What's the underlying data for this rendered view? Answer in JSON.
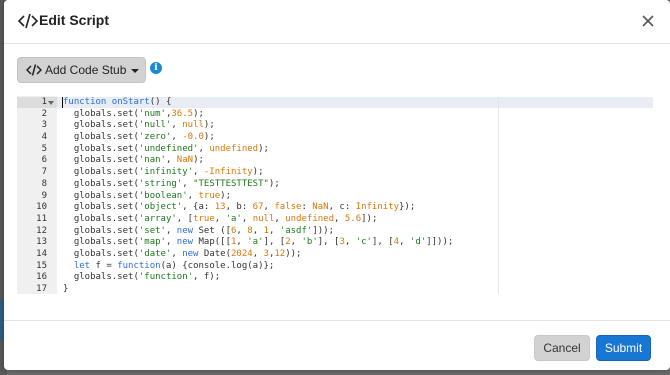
{
  "modal": {
    "title": "Edit Script"
  },
  "toolbar": {
    "add_code_stub_label": "Add Code Stub",
    "info_glyph": "i"
  },
  "editor": {
    "lines": [
      {
        "n": "1",
        "tokens": [
          [
            "k",
            "function"
          ],
          [
            "p",
            " "
          ],
          [
            "fn",
            "onStart"
          ],
          [
            "p",
            "() {"
          ]
        ]
      },
      {
        "n": "2",
        "tokens": [
          [
            "p",
            "  globals.set("
          ],
          [
            "s",
            "'num'"
          ],
          [
            "p",
            ","
          ],
          [
            "c",
            "36.5"
          ],
          [
            "p",
            ");"
          ]
        ]
      },
      {
        "n": "3",
        "tokens": [
          [
            "p",
            "  globals.set("
          ],
          [
            "s",
            "'null'"
          ],
          [
            "p",
            ", "
          ],
          [
            "c",
            "null"
          ],
          [
            "p",
            ");"
          ]
        ]
      },
      {
        "n": "4",
        "tokens": [
          [
            "p",
            "  globals.set("
          ],
          [
            "s",
            "'zero'"
          ],
          [
            "p",
            ", "
          ],
          [
            "c",
            "-0.0"
          ],
          [
            "p",
            ");"
          ]
        ]
      },
      {
        "n": "5",
        "tokens": [
          [
            "p",
            "  globals.set("
          ],
          [
            "s",
            "'undefined'"
          ],
          [
            "p",
            ", "
          ],
          [
            "c",
            "undefined"
          ],
          [
            "p",
            ");"
          ]
        ]
      },
      {
        "n": "6",
        "tokens": [
          [
            "p",
            "  globals.set("
          ],
          [
            "s",
            "'nan'"
          ],
          [
            "p",
            ", "
          ],
          [
            "c",
            "NaN"
          ],
          [
            "p",
            ");"
          ]
        ]
      },
      {
        "n": "7",
        "tokens": [
          [
            "p",
            "  globals.set("
          ],
          [
            "s",
            "'infinity'"
          ],
          [
            "p",
            ", "
          ],
          [
            "c",
            "-Infinity"
          ],
          [
            "p",
            ");"
          ]
        ]
      },
      {
        "n": "8",
        "tokens": [
          [
            "p",
            "  globals.set("
          ],
          [
            "s",
            "'string'"
          ],
          [
            "p",
            ", "
          ],
          [
            "s",
            "\"TESTTESTTEST\""
          ],
          [
            "p",
            ");"
          ]
        ]
      },
      {
        "n": "9",
        "tokens": [
          [
            "p",
            "  globals.set("
          ],
          [
            "s",
            "'boolean'"
          ],
          [
            "p",
            ", "
          ],
          [
            "c",
            "true"
          ],
          [
            "p",
            ");"
          ]
        ]
      },
      {
        "n": "10",
        "tokens": [
          [
            "p",
            "  globals.set("
          ],
          [
            "s",
            "'object'"
          ],
          [
            "p",
            ", {a: "
          ],
          [
            "c",
            "13"
          ],
          [
            "p",
            ", b: "
          ],
          [
            "c",
            "67"
          ],
          [
            "p",
            ", "
          ],
          [
            "c",
            "false"
          ],
          [
            "p",
            ": "
          ],
          [
            "c",
            "NaN"
          ],
          [
            "p",
            ", c: "
          ],
          [
            "c",
            "Infinity"
          ],
          [
            "p",
            "});"
          ]
        ]
      },
      {
        "n": "11",
        "tokens": [
          [
            "p",
            "  globals.set("
          ],
          [
            "s",
            "'array'"
          ],
          [
            "p",
            ", ["
          ],
          [
            "c",
            "true"
          ],
          [
            "p",
            ", "
          ],
          [
            "s",
            "'a'"
          ],
          [
            "p",
            ", "
          ],
          [
            "c",
            "null"
          ],
          [
            "p",
            ", "
          ],
          [
            "c",
            "undefined"
          ],
          [
            "p",
            ", "
          ],
          [
            "c",
            "5.6"
          ],
          [
            "p",
            "]);"
          ]
        ]
      },
      {
        "n": "12",
        "tokens": [
          [
            "p",
            "  globals.set("
          ],
          [
            "s",
            "'set'"
          ],
          [
            "p",
            ", "
          ],
          [
            "k",
            "new"
          ],
          [
            "p",
            " Set (["
          ],
          [
            "c",
            "6"
          ],
          [
            "p",
            ", "
          ],
          [
            "c",
            "8"
          ],
          [
            "p",
            ", "
          ],
          [
            "c",
            "1"
          ],
          [
            "p",
            ", "
          ],
          [
            "s",
            "'asdf'"
          ],
          [
            "p",
            "]));"
          ]
        ]
      },
      {
        "n": "13",
        "tokens": [
          [
            "p",
            "  globals.set("
          ],
          [
            "s",
            "'map'"
          ],
          [
            "p",
            ", "
          ],
          [
            "k",
            "new"
          ],
          [
            "p",
            " Map([["
          ],
          [
            "c",
            "1"
          ],
          [
            "p",
            ", "
          ],
          [
            "s",
            "'a'"
          ],
          [
            "p",
            "], ["
          ],
          [
            "c",
            "2"
          ],
          [
            "p",
            ", "
          ],
          [
            "s",
            "'b'"
          ],
          [
            "p",
            "], ["
          ],
          [
            "c",
            "3"
          ],
          [
            "p",
            ", "
          ],
          [
            "s",
            "'c'"
          ],
          [
            "p",
            "], ["
          ],
          [
            "c",
            "4"
          ],
          [
            "p",
            ", "
          ],
          [
            "s",
            "'d'"
          ],
          [
            "p",
            "]]));"
          ]
        ]
      },
      {
        "n": "14",
        "tokens": [
          [
            "p",
            "  globals.set("
          ],
          [
            "s",
            "'date'"
          ],
          [
            "p",
            ", "
          ],
          [
            "k",
            "new"
          ],
          [
            "p",
            " Date("
          ],
          [
            "c",
            "2024"
          ],
          [
            "p",
            ", "
          ],
          [
            "c",
            "3"
          ],
          [
            "p",
            ","
          ],
          [
            "c",
            "12"
          ],
          [
            "p",
            "));"
          ]
        ]
      },
      {
        "n": "15",
        "tokens": [
          [
            "p",
            "  "
          ],
          [
            "k",
            "let"
          ],
          [
            "p",
            " f = "
          ],
          [
            "k",
            "function"
          ],
          [
            "p",
            "(a) {console.log(a)};"
          ]
        ]
      },
      {
        "n": "16",
        "tokens": [
          [
            "p",
            "  globals.set("
          ],
          [
            "s",
            "'function'"
          ],
          [
            "p",
            ", f);"
          ]
        ]
      },
      {
        "n": "17",
        "tokens": [
          [
            "p",
            "}"
          ]
        ]
      }
    ]
  },
  "footer": {
    "cancel_label": "Cancel",
    "submit_label": "Submit"
  },
  "colors": {
    "keyword": "#2a6fd6",
    "string": "#1a7a1a",
    "constant": "#d97706",
    "primary_button": "#1877d2"
  }
}
